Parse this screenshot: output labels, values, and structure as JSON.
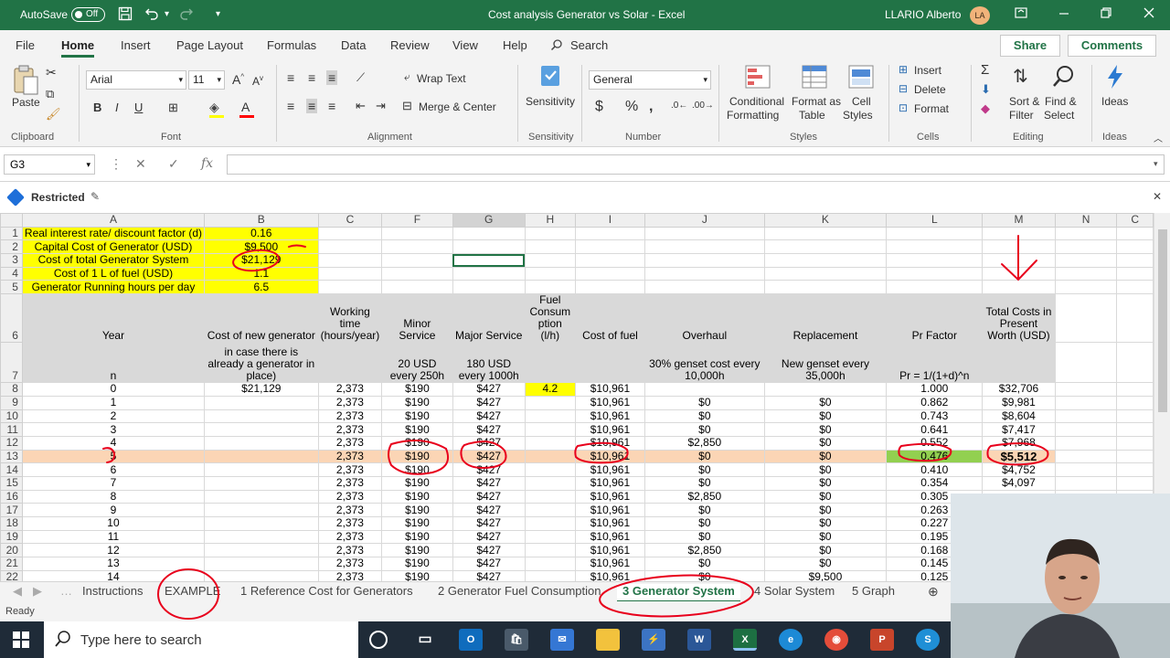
{
  "window": {
    "autosave_label": "AutoSave",
    "autosave_state": "Off",
    "title": "Cost analysis Generator vs Solar  -  Excel",
    "user": "LLARIO Alberto",
    "user_initials": "LA"
  },
  "ribbon_tabs": [
    "File",
    "Home",
    "Insert",
    "Page Layout",
    "Formulas",
    "Data",
    "Review",
    "View",
    "Help"
  ],
  "search_label": "Search",
  "share_label": "Share",
  "comments_label": "Comments",
  "ribbon": {
    "paste": "Paste",
    "font_name": "Arial",
    "font_size": "11",
    "wrap_text": "Wrap Text",
    "merge_center": "Merge & Center",
    "sensitivity": "Sensitivity",
    "number_format": "General",
    "conditional_formatting_1": "Conditional",
    "conditional_formatting_2": "Formatting",
    "format_as_table_1": "Format as",
    "format_as_table_2": "Table",
    "cell_styles_1": "Cell",
    "cell_styles_2": "Styles",
    "insert": "Insert",
    "delete": "Delete",
    "format": "Format",
    "sort_filter_1": "Sort &",
    "sort_filter_2": "Filter",
    "find_select_1": "Find &",
    "find_select_2": "Select",
    "ideas": "Ideas",
    "groups": {
      "clipboard": "Clipboard",
      "font": "Font",
      "alignment": "Alignment",
      "sensitivity": "Sensitivity",
      "number": "Number",
      "styles": "Styles",
      "cells": "Cells",
      "editing": "Editing",
      "ideas": "Ideas"
    }
  },
  "formula_bar": {
    "name_box": "G3",
    "fx": "fx",
    "formula": ""
  },
  "restricted_label": "Restricted",
  "columns": [
    "A",
    "B",
    "C",
    "F",
    "G",
    "H",
    "I",
    "J",
    "K",
    "L",
    "M",
    "N",
    "C"
  ],
  "params": [
    {
      "label": "Real interest rate/ discount factor (d)",
      "value": "0.16"
    },
    {
      "label": "Capital Cost of Generator (USD)",
      "value": "$9,500"
    },
    {
      "label": "Cost of total Generator System",
      "value": "$21,129"
    },
    {
      "label": "Cost of 1 L of fuel (USD)",
      "value": "1.1"
    },
    {
      "label": "Generator Running hours per day",
      "value": "6.5"
    }
  ],
  "headers_row6": {
    "year": "Year",
    "new_generator": "Cost of new generator",
    "working_time_1": "Working",
    "working_time_2": "time",
    "working_time_3": "(hours/year)",
    "minor_1": "Minor",
    "minor_2": "Service",
    "major": "Major Service",
    "fuel_1": "Fuel",
    "fuel_2": "Consum",
    "fuel_3": "ption (l/h)",
    "cost_fuel": "Cost of fuel",
    "overhaul": "Overhaul",
    "replacement": "Replacement",
    "pr_factor": "Pr Factor",
    "total_1": "Total Costs in",
    "total_2": "Present",
    "total_3": "Worth (USD)"
  },
  "headers_row7": {
    "n": "n",
    "new_gen_1": "in case there is",
    "new_gen_2": "already a generator in",
    "new_gen_3": "place)",
    "minor_1": "20 USD",
    "minor_2": "every 250h",
    "major_1": "180 USD",
    "major_2": "every 1000h",
    "overhaul_1": "30% genset cost every",
    "overhaul_2": "10,000h",
    "replacement_1": "New genset every",
    "replacement_2": "35,000h",
    "pr": "Pr = 1/(1+d)^n"
  },
  "rows": [
    {
      "r": "8",
      "n": "0",
      "b": "$21,129",
      "c": "2,373",
      "f": "$190",
      "g": "$427",
      "h": "4.2",
      "i": "$10,961",
      "j": "",
      "k": "",
      "l": "1.000",
      "m": "$32,706"
    },
    {
      "r": "9",
      "n": "1",
      "b": "",
      "c": "2,373",
      "f": "$190",
      "g": "$427",
      "h": "",
      "i": "$10,961",
      "j": "$0",
      "k": "$0",
      "l": "0.862",
      "m": "$9,981"
    },
    {
      "r": "10",
      "n": "2",
      "b": "",
      "c": "2,373",
      "f": "$190",
      "g": "$427",
      "h": "",
      "i": "$10,961",
      "j": "$0",
      "k": "$0",
      "l": "0.743",
      "m": "$8,604"
    },
    {
      "r": "11",
      "n": "3",
      "b": "",
      "c": "2,373",
      "f": "$190",
      "g": "$427",
      "h": "",
      "i": "$10,961",
      "j": "$0",
      "k": "$0",
      "l": "0.641",
      "m": "$7,417"
    },
    {
      "r": "12",
      "n": "4",
      "b": "",
      "c": "2,373",
      "f": "$190",
      "g": "$427",
      "h": "",
      "i": "$10,961",
      "j": "$2,850",
      "k": "$0",
      "l": "0.552",
      "m": "$7,968"
    },
    {
      "r": "13",
      "n": "5",
      "b": "",
      "c": "2,373",
      "f": "$190",
      "g": "$427",
      "h": "",
      "i": "$10,961",
      "j": "$0",
      "k": "$0",
      "l": "0.476",
      "m": "$5,512"
    },
    {
      "r": "14",
      "n": "6",
      "b": "",
      "c": "2,373",
      "f": "$190",
      "g": "$427",
      "h": "",
      "i": "$10,961",
      "j": "$0",
      "k": "$0",
      "l": "0.410",
      "m": "$4,752"
    },
    {
      "r": "15",
      "n": "7",
      "b": "",
      "c": "2,373",
      "f": "$190",
      "g": "$427",
      "h": "",
      "i": "$10,961",
      "j": "$0",
      "k": "$0",
      "l": "0.354",
      "m": "$4,097"
    },
    {
      "r": "16",
      "n": "8",
      "b": "",
      "c": "2,373",
      "f": "$190",
      "g": "$427",
      "h": "",
      "i": "$10,961",
      "j": "$2,850",
      "k": "$0",
      "l": "0.305",
      "m": ""
    },
    {
      "r": "17",
      "n": "9",
      "b": "",
      "c": "2,373",
      "f": "$190",
      "g": "$427",
      "h": "",
      "i": "$10,961",
      "j": "$0",
      "k": "$0",
      "l": "0.263",
      "m": ""
    },
    {
      "r": "18",
      "n": "10",
      "b": "",
      "c": "2,373",
      "f": "$190",
      "g": "$427",
      "h": "",
      "i": "$10,961",
      "j": "$0",
      "k": "$0",
      "l": "0.227",
      "m": ""
    },
    {
      "r": "19",
      "n": "11",
      "b": "",
      "c": "2,373",
      "f": "$190",
      "g": "$427",
      "h": "",
      "i": "$10,961",
      "j": "$0",
      "k": "$0",
      "l": "0.195",
      "m": ""
    },
    {
      "r": "20",
      "n": "12",
      "b": "",
      "c": "2,373",
      "f": "$190",
      "g": "$427",
      "h": "",
      "i": "$10,961",
      "j": "$2,850",
      "k": "$0",
      "l": "0.168",
      "m": ""
    },
    {
      "r": "21",
      "n": "13",
      "b": "",
      "c": "2,373",
      "f": "$190",
      "g": "$427",
      "h": "",
      "i": "$10,961",
      "j": "$0",
      "k": "$0",
      "l": "0.145",
      "m": ""
    },
    {
      "r": "22",
      "n": "14",
      "b": "",
      "c": "2,373",
      "f": "$190",
      "g": "$427",
      "h": "",
      "i": "$10,961",
      "j": "$0",
      "k": "$9,500",
      "l": "0.125",
      "m": ""
    }
  ],
  "sheet_tabs": [
    "Instructions",
    "EXAMPLE",
    "1 Reference Cost for Generators",
    "2 Generator Fuel Consumption",
    "3 Generator System",
    "4 Solar System",
    "5 Graph"
  ],
  "status": "Ready",
  "taskbar_search": "Type here to search",
  "colors": {
    "excel_green": "#217346",
    "param_yellow": "#ffff00",
    "highlight_row": "#fbd5b5",
    "pr_factor_green": "#92d050",
    "annotation_red": "#e8001c"
  }
}
